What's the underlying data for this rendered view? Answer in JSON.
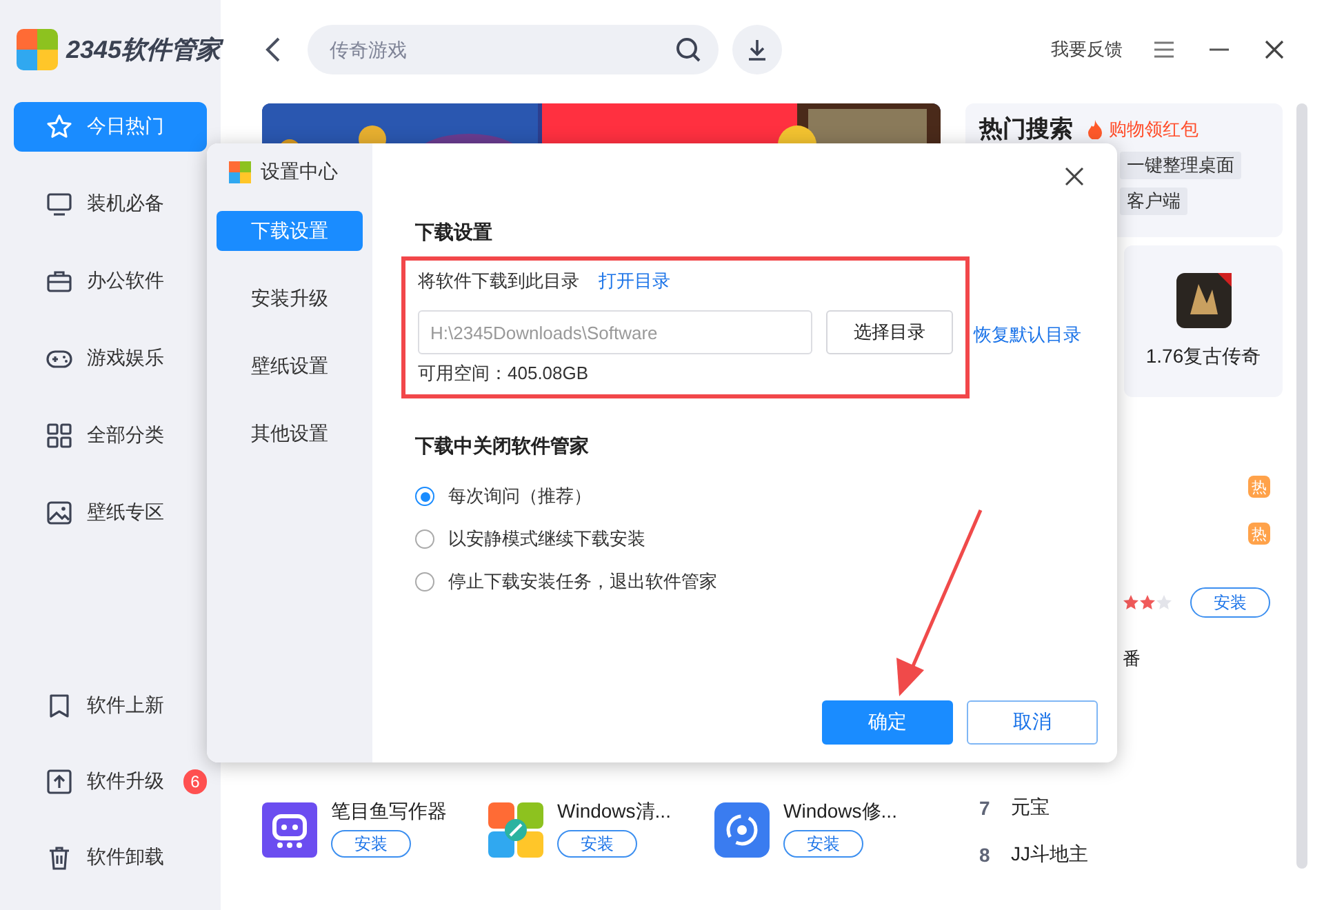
{
  "app": {
    "logo_text": "2345软件管家"
  },
  "sidebar": {
    "items": [
      {
        "label": "今日热门",
        "selected": true
      },
      {
        "label": "装机必备",
        "selected": false
      },
      {
        "label": "办公软件",
        "selected": false
      },
      {
        "label": "游戏娱乐",
        "selected": false
      },
      {
        "label": "全部分类",
        "selected": false
      },
      {
        "label": "壁纸专区",
        "selected": false
      }
    ],
    "bottom_items": [
      {
        "label": "软件上新",
        "selected": false
      },
      {
        "label": "软件升级",
        "badge": "6",
        "selected": false
      },
      {
        "label": "软件卸载",
        "selected": false
      }
    ]
  },
  "topbar": {
    "search": {
      "placeholder": "传奇游戏"
    },
    "feedback": "我要反馈"
  },
  "hot_search": {
    "title": "热门搜索",
    "promo": "购物领红包",
    "tags": [
      "一键整理桌面",
      "客户端"
    ]
  },
  "featured_card": {
    "name": "1.76复古传奇"
  },
  "hot_badges": [
    "热",
    "热"
  ],
  "rating": {
    "stars": 2
  },
  "install_button": "安装",
  "partial_text": "番",
  "apps": [
    {
      "name": "笔目鱼写作器",
      "button": "安装"
    },
    {
      "name": "Windows清...",
      "button": "安装"
    },
    {
      "name": "Windows修...",
      "button": "安装"
    }
  ],
  "ranking": [
    {
      "rank": "7",
      "name": "元宝"
    },
    {
      "rank": "8",
      "name": "JJ斗地主"
    }
  ],
  "dialog": {
    "title": "设置中心",
    "nav": [
      {
        "label": "下载设置",
        "selected": true
      },
      {
        "label": "安装升级",
        "selected": false
      },
      {
        "label": "壁纸设置",
        "selected": false
      },
      {
        "label": "其他设置",
        "selected": false
      }
    ],
    "section_title": "下载设置",
    "directory_label": "将软件下载到此目录",
    "open_link": "打开目录",
    "path": "H:\\2345Downloads\\Software",
    "choose_button": "选择目录",
    "restore_link": "恢复默认目录",
    "free_space": "可用空间：405.08GB",
    "close_section_title": "下载中关闭软件管家",
    "options": [
      {
        "label": "每次询问（推荐）",
        "selected": true
      },
      {
        "label": "以安静模式继续下载安装",
        "selected": false
      },
      {
        "label": "停止下载安装任务，退出软件管家",
        "selected": false
      }
    ],
    "buttons": [
      {
        "label": "确定",
        "kind": "primary"
      },
      {
        "label": "取消",
        "kind": "secondary"
      }
    ]
  },
  "annotations": {
    "highlight_frame": true,
    "arrow": true
  }
}
